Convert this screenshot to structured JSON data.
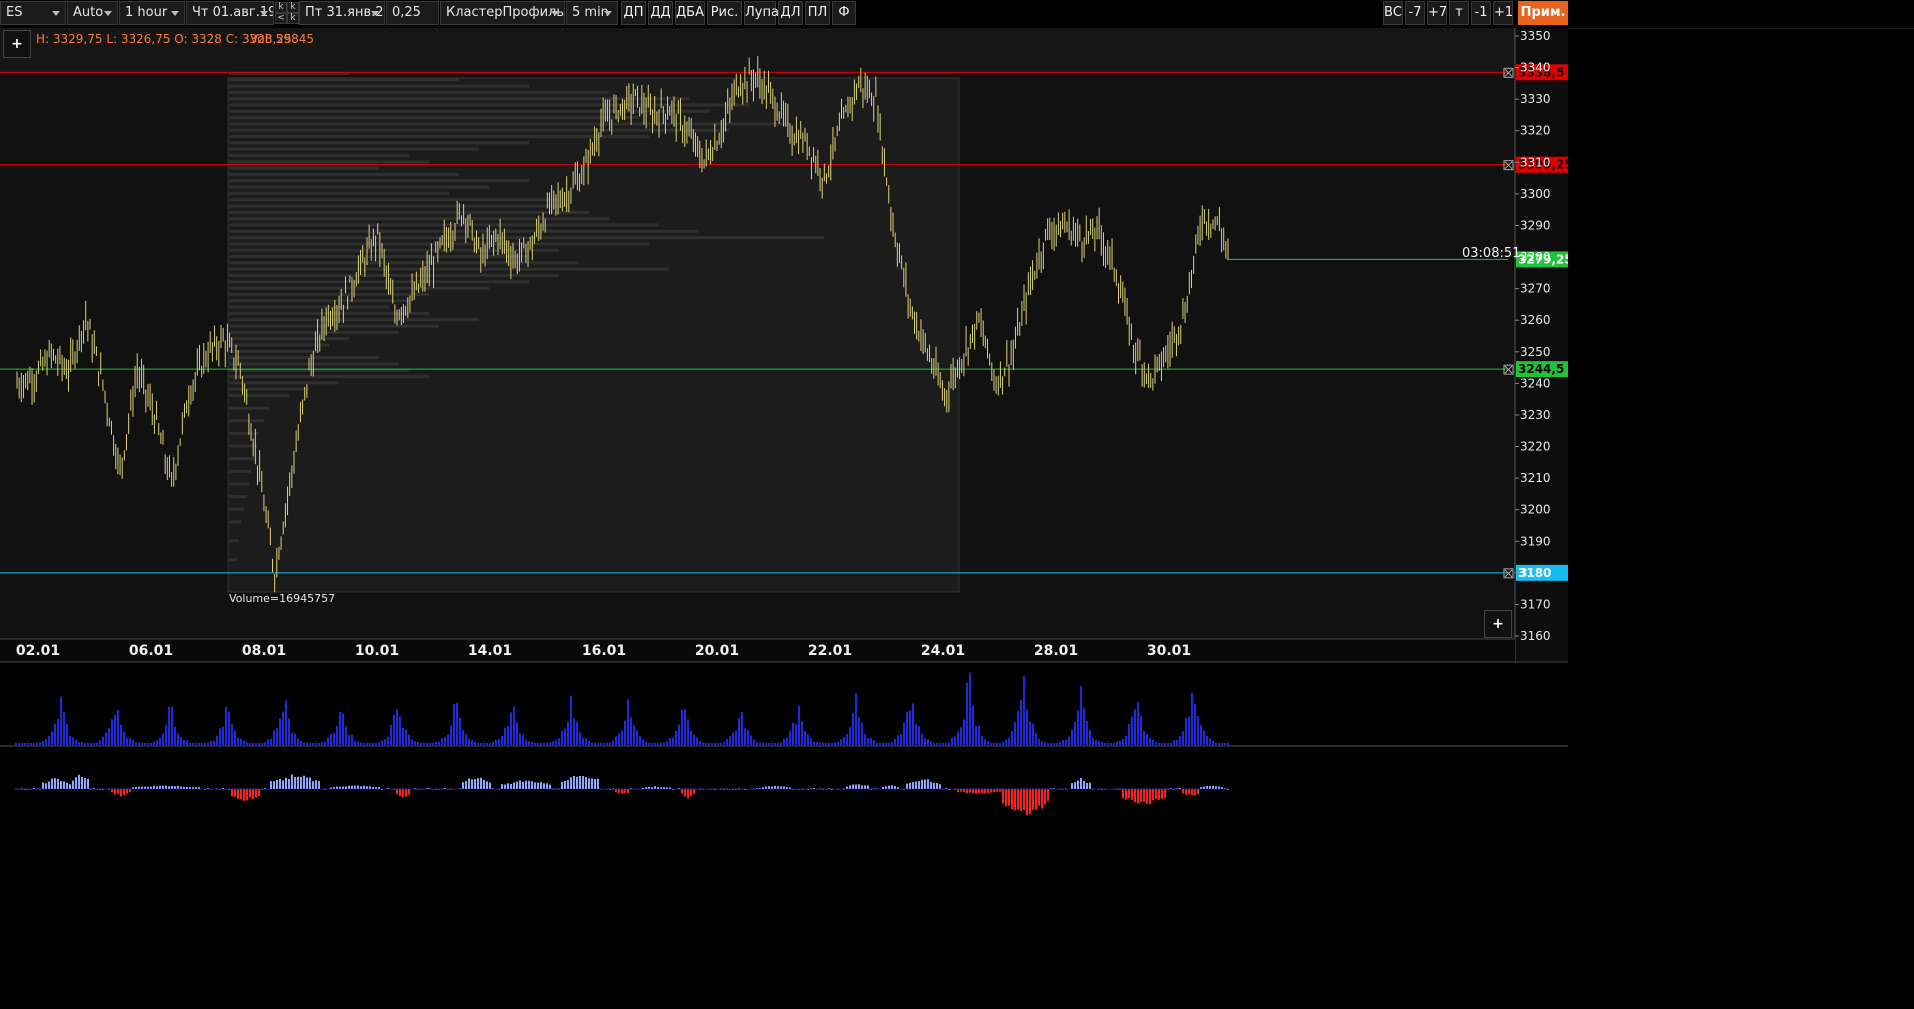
{
  "toolbar": {
    "symbol": "ES",
    "mode": "Auto",
    "timeframe": "1 hour",
    "date_from": "Чт 01.авг.19",
    "date_to": "Пт 31.янв.20",
    "k1": "k",
    "k2": "k",
    "k3": "<",
    "k4": "k",
    "tick": "0,25",
    "chart_type": "КластерПрофиль",
    "profile_period": "5 min",
    "buttons": [
      "ДП",
      "ДД",
      "ДБА",
      "Рис.",
      "Лупа",
      "ДЛ",
      "ПЛ",
      "Ф"
    ],
    "right_buttons": [
      "ВС",
      "-7",
      "+7",
      "т",
      "-1",
      "+1"
    ],
    "apply_label": "Прим."
  },
  "info": {
    "ohlc": "H: 3329,75 L: 3326,75 O: 3328 C: 3328,25",
    "vol": "Vol: 59845"
  },
  "chart": {
    "plus_label": "+",
    "volume_label": "Volume=16945757",
    "timer": "03:08:51",
    "colors": {
      "up": "#d8d27a",
      "resistance": "#e00000",
      "support": "#1dc43a",
      "level_blue": "#16bdf3",
      "volume": "#1f29e0",
      "delta_pos": "#8fa8ff",
      "delta_neg": "#ff2020"
    }
  },
  "chart_data": {
    "type": "candlestick",
    "instrument": "ES",
    "timeframe": "1 hour",
    "y_axis": {
      "ticks": [
        3350,
        3340,
        3330,
        3320,
        3310,
        3300,
        3290,
        3280,
        3270,
        3260,
        3250,
        3240,
        3230,
        3220,
        3210,
        3200,
        3190,
        3180,
        3170,
        3160
      ],
      "range": [
        3157,
        3352
      ]
    },
    "x_axis": {
      "ticks": [
        "02.01",
        "06.01",
        "08.01",
        "10.01",
        "14.01",
        "16.01",
        "20.01",
        "22.01",
        "24.01",
        "28.01",
        "30.01"
      ]
    },
    "price_path": [
      [
        0,
        3240
      ],
      [
        2,
        3242
      ],
      [
        4,
        3249
      ],
      [
        6,
        3244
      ],
      [
        8,
        3261
      ],
      [
        10,
        3240
      ],
      [
        12,
        3212
      ],
      [
        14,
        3244
      ],
      [
        16,
        3230
      ],
      [
        18,
        3208
      ],
      [
        20,
        3237
      ],
      [
        22,
        3249
      ],
      [
        24,
        3254
      ],
      [
        26,
        3245
      ],
      [
        28,
        3215
      ],
      [
        30,
        3180
      ],
      [
        32,
        3212
      ],
      [
        34,
        3244
      ],
      [
        36,
        3261
      ],
      [
        38,
        3266
      ],
      [
        40,
        3277
      ],
      [
        42,
        3287
      ],
      [
        44,
        3262
      ],
      [
        46,
        3267
      ],
      [
        48,
        3276
      ],
      [
        50,
        3286
      ],
      [
        52,
        3295
      ],
      [
        54,
        3280
      ],
      [
        56,
        3287
      ],
      [
        58,
        3279
      ],
      [
        60,
        3284
      ],
      [
        62,
        3296
      ],
      [
        64,
        3300
      ],
      [
        66,
        3307
      ],
      [
        68,
        3322
      ],
      [
        70,
        3327
      ],
      [
        72,
        3330
      ],
      [
        74,
        3325
      ],
      [
        76,
        3327
      ],
      [
        78,
        3320
      ],
      [
        80,
        3310
      ],
      [
        82,
        3320
      ],
      [
        84,
        3335
      ],
      [
        86,
        3337
      ],
      [
        88,
        3330
      ],
      [
        90,
        3320
      ],
      [
        92,
        3316
      ],
      [
        94,
        3305
      ],
      [
        96,
        3322
      ],
      [
        98,
        3335
      ],
      [
        100,
        3330
      ],
      [
        102,
        3290
      ],
      [
        104,
        3264
      ],
      [
        106,
        3250
      ],
      [
        108,
        3236
      ],
      [
        110,
        3248
      ],
      [
        112,
        3260
      ],
      [
        114,
        3240
      ],
      [
        116,
        3250
      ],
      [
        118,
        3272
      ],
      [
        120,
        3288
      ],
      [
        122,
        3290
      ],
      [
        124,
        3286
      ],
      [
        126,
        3288
      ],
      [
        128,
        3275
      ],
      [
        130,
        3252
      ],
      [
        132,
        3241
      ],
      [
        134,
        3250
      ],
      [
        136,
        3263
      ],
      [
        138,
        3293
      ],
      [
        140,
        3290
      ],
      [
        141,
        3281
      ]
    ],
    "levels": [
      {
        "price": "3338,5",
        "color": "#e00000"
      },
      {
        "price": "3309,25",
        "color": "#e00000"
      },
      {
        "price": "3279,25",
        "color": "#1dc43a"
      },
      {
        "price": "3244,5",
        "color": "#1dc43a"
      },
      {
        "price": "3180",
        "color": "#16bdf3"
      }
    ]
  }
}
